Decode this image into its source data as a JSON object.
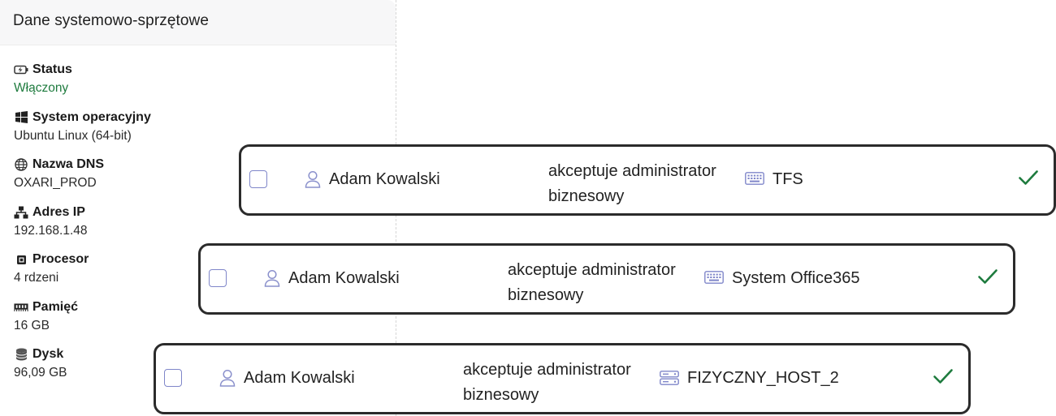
{
  "panel": {
    "title": "Dane systemowo-sprzętowe",
    "properties": [
      {
        "label": "Status",
        "value": "Włączony",
        "icon": "battery-charging-icon",
        "value_color": "#1e7b3e"
      },
      {
        "label": "System operacyjny",
        "value": "Ubuntu Linux (64-bit)",
        "icon": "windows-icon"
      },
      {
        "label": "Nazwa DNS",
        "value": "OXARI_PROD",
        "icon": "globe-icon"
      },
      {
        "label": "Adres IP",
        "value": "192.168.1.48",
        "icon": "network-icon"
      },
      {
        "label": "Procesor",
        "value": "4 rdzeni",
        "icon": "cpu-icon"
      },
      {
        "label": "Pamięć",
        "value": "16 GB",
        "icon": "memory-icon"
      },
      {
        "label": "Dysk",
        "value": "96,09 GB",
        "icon": "database-icon"
      }
    ]
  },
  "rows": [
    {
      "user": "Adam Kowalski",
      "role": "akceptuje administrator biznesowy",
      "system": "TFS",
      "system_icon": "keyboard-icon",
      "status_icon": "checkmark-icon"
    },
    {
      "user": "Adam Kowalski",
      "role": "akceptuje administrator biznesowy",
      "system": "System Office365",
      "system_icon": "keyboard-icon",
      "status_icon": "checkmark-icon"
    },
    {
      "user": "Adam Kowalski",
      "role": "akceptuje administrator biznesowy",
      "system": "FIZYCZNY_HOST_2",
      "system_icon": "server-icon",
      "status_icon": "checkmark-icon"
    }
  ],
  "colors": {
    "accent": "#7f86c9",
    "success": "#1e7b3e",
    "border": "#2b2b2b"
  }
}
